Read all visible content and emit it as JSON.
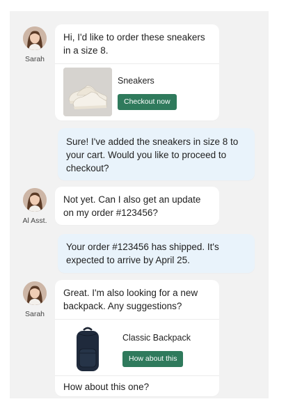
{
  "messages": [
    {
      "sender": "Sarah",
      "text": "Hi, I'd like to order these sneakers in a size 8.",
      "product": {
        "name": "Sneakers",
        "button": "Checkout now",
        "image_icon": "sneakers-image"
      }
    },
    {
      "sender": "AI Asst.",
      "text": "Sure! I've added the sneakers in size 8 to your cart. Would you like to proceed to checkout?"
    },
    {
      "sender": "AI Asst.",
      "text": "Not yet. Can I also get an update on my order #123456?"
    },
    {
      "sender": "AI Asst.",
      "text": "Your order #123456 has shipped. It's expected to arrive by April 25."
    },
    {
      "sender": "Sarah",
      "text": "Great. I'm also looking for a new backpack. Any suggestions?",
      "product": {
        "name": "Classic Backpack",
        "button": "How about this",
        "image_icon": "backpack-image"
      },
      "footer": "How about this one?"
    }
  ],
  "labels": {
    "sarah": "Sarah",
    "assistant": "Al Asst."
  },
  "colors": {
    "canvas": "#f2f2f2",
    "user_bubble": "#ffffff",
    "assistant_bubble": "#e9f3fb",
    "button": "#2f7a5c"
  }
}
